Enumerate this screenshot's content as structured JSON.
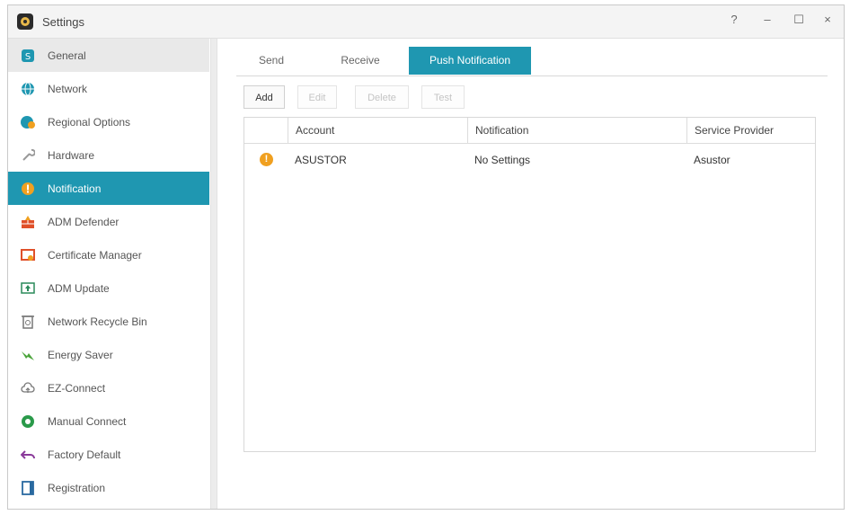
{
  "window": {
    "title": "Settings",
    "help_label": "?",
    "minimize_label": "–",
    "maximize_label": "☐",
    "close_label": "×"
  },
  "sidebar": {
    "items": [
      {
        "label": "General",
        "icon": "general-icon",
        "color": "#1f97b1"
      },
      {
        "label": "Network",
        "icon": "globe-icon",
        "color": "#1f97b1"
      },
      {
        "label": "Regional Options",
        "icon": "regional-icon",
        "color": "#1f97b1"
      },
      {
        "label": "Hardware",
        "icon": "wrench-icon",
        "color": "#999999"
      },
      {
        "label": "Notification",
        "icon": "notification-icon",
        "color": "#f0a020"
      },
      {
        "label": "ADM Defender",
        "icon": "firewall-icon",
        "color": "#e0502a"
      },
      {
        "label": "Certificate Manager",
        "icon": "certificate-icon",
        "color": "#e0502a"
      },
      {
        "label": "ADM Update",
        "icon": "update-icon",
        "color": "#2a8a5a"
      },
      {
        "label": "Network Recycle Bin",
        "icon": "recycle-bin-icon",
        "color": "#777777"
      },
      {
        "label": "Energy Saver",
        "icon": "leaf-icon",
        "color": "#4aa43a"
      },
      {
        "label": "EZ-Connect",
        "icon": "cloud-icon",
        "color": "#777777"
      },
      {
        "label": "Manual Connect",
        "icon": "manual-connect-icon",
        "color": "#2a9a4a"
      },
      {
        "label": "Factory Default",
        "icon": "undo-icon",
        "color": "#8a3a9a"
      },
      {
        "label": "Registration",
        "icon": "registration-icon",
        "color": "#2a6aa0"
      }
    ],
    "active_index": 4,
    "highlight_index": 0
  },
  "tabs": [
    {
      "label": "Send"
    },
    {
      "label": "Receive"
    },
    {
      "label": "Push Notification"
    }
  ],
  "active_tab": 2,
  "toolbar": {
    "add_label": "Add",
    "edit_label": "Edit",
    "delete_label": "Delete",
    "test_label": "Test"
  },
  "table": {
    "columns": [
      "Account",
      "Notification",
      "Service Provider"
    ],
    "rows": [
      {
        "status_icon": "warning-icon",
        "status_symbol": "!",
        "account": "ASUSTOR",
        "notification": "No Settings",
        "service_provider": "Asustor"
      }
    ]
  },
  "colors": {
    "accent": "#1f97b1",
    "warning": "#f0a020"
  }
}
